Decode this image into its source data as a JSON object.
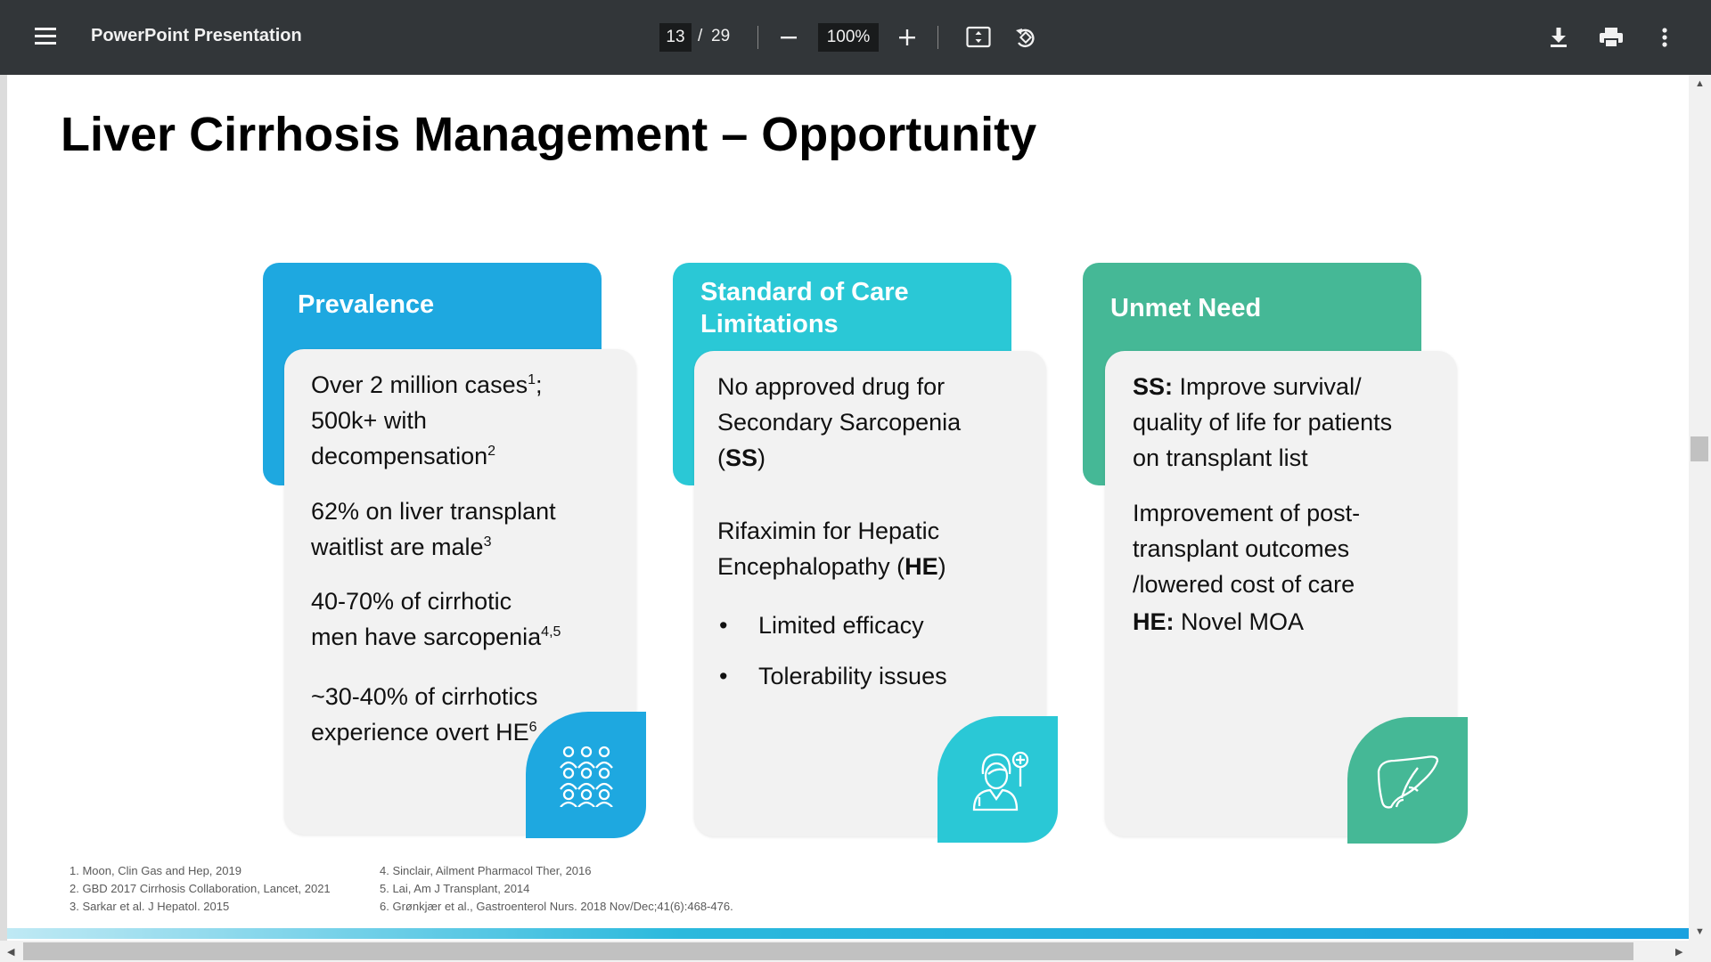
{
  "viewer": {
    "title": "PowerPoint Presentation",
    "page_current": "13",
    "page_separator": "/",
    "page_total": "29",
    "zoom": "100%"
  },
  "colors": {
    "toolbar": "#323639",
    "prevalence": "#1ea8e0",
    "standard": "#2ac8d6",
    "unmet": "#45b896"
  },
  "slide": {
    "title": "Liver Cirrhosis Management  –  Opportunity",
    "cards": [
      {
        "header": "Prevalence",
        "icon": "people-group-icon",
        "paras": [
          {
            "text": "Over 2 million cases",
            "sup": "1",
            "rest": ";"
          },
          {
            "text": "500k+ with"
          },
          {
            "text": "decompensation",
            "sup": "2"
          },
          {
            "text": "62% on liver transplant"
          },
          {
            "text": "waitlist are male",
            "sup": "3"
          },
          {
            "text": "40-70% of cirrhotic"
          },
          {
            "text": "men have sarcopenia",
            "sup": "4,5"
          },
          {
            "text": "~30-40% of cirrhotics"
          },
          {
            "text": "experience overt HE",
            "sup": "6"
          }
        ]
      },
      {
        "header": "Standard of Care Limitations",
        "icon": "doctor-icon",
        "lines": [
          {
            "pre": "No approved drug for"
          },
          {
            "pre": "Secondary Sarcopenia"
          },
          {
            "pre": "(",
            "bold": "SS",
            "post": ")"
          },
          {
            "pre": "Rifaximin for Hepatic"
          },
          {
            "pre": "Encephalopathy (",
            "bold": "HE",
            "post": ")"
          }
        ],
        "bullets": [
          "Limited efficacy",
          "Tolerability issues"
        ]
      },
      {
        "header": "Unmet Need",
        "icon": "liver-icon",
        "lines": [
          {
            "bold": "SS:",
            "post": " Improve  survival/"
          },
          {
            "pre": "quality of life for patients"
          },
          {
            "pre": "on transplant list"
          },
          {
            "pre": "Improvement of post-"
          },
          {
            "pre": "transplant outcomes"
          },
          {
            "pre": "/lowered cost of care"
          },
          {
            "bold": "HE:",
            "post": " Novel MOA"
          }
        ]
      }
    ],
    "footnotes_left": [
      "1. Moon, Clin Gas and Hep, 2019",
      "2. GBD 2017 Cirrhosis Collaboration, Lancet, 2021",
      "3. Sarkar et al. J Hepatol. 2015"
    ],
    "footnotes_right": [
      "4. Sinclair, Ailment Pharmacol Ther, 2016",
      "5. Lai, Am J Transplant, 2014",
      "6. Grønkjær et al., Gastroenterol Nurs. 2018 Nov/Dec;41(6):468-476."
    ]
  }
}
